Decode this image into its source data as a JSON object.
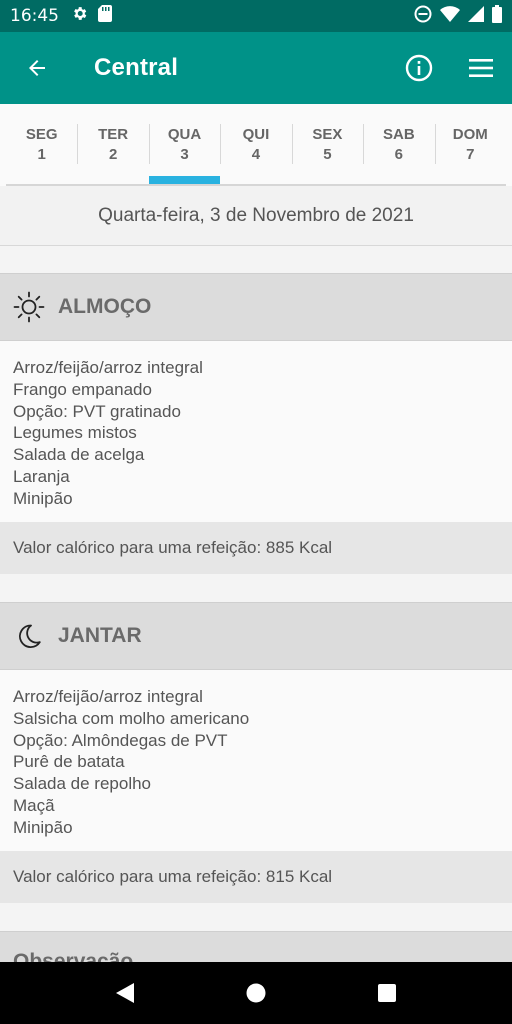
{
  "status_bar": {
    "time": "16:45",
    "left_icons": [
      "settings-icon",
      "sd-card-icon"
    ],
    "right_icons": [
      "do-not-disturb-icon",
      "wifi-icon",
      "signal-icon",
      "battery-icon"
    ]
  },
  "app_bar": {
    "title": "Central",
    "back_icon": "arrow-back-icon",
    "actions": [
      "info-icon",
      "menu-icon"
    ]
  },
  "tabs": [
    {
      "day": "SEG",
      "num": "1"
    },
    {
      "day": "TER",
      "num": "2"
    },
    {
      "day": "QUA",
      "num": "3",
      "selected": true
    },
    {
      "day": "QUI",
      "num": "4"
    },
    {
      "day": "SEX",
      "num": "5"
    },
    {
      "day": "SAB",
      "num": "6"
    },
    {
      "day": "DOM",
      "num": "7"
    }
  ],
  "date_label": "Quarta-feira, 3 de Novembro de 2021",
  "meals": [
    {
      "icon": "sun-icon",
      "title": "ALMOÇO",
      "items": [
        "Arroz/feijão/arroz integral",
        "Frango empanado",
        "Opção: PVT gratinado",
        "Legumes mistos",
        "Salada de acelga",
        "Laranja",
        "Minipão"
      ],
      "calories": "Valor calórico para uma refeição: 885 Kcal"
    },
    {
      "icon": "moon-icon",
      "title": "JANTAR",
      "items": [
        "Arroz/feijão/arroz integral",
        "Salsicha com molho americano",
        "Opção: Almôndegas de PVT",
        "Purê de batata",
        "Salada de repolho",
        "Maçã",
        "Minipão"
      ],
      "calories": "Valor calórico para uma refeição: 815 Kcal"
    }
  ],
  "observacao_title": "Observação",
  "nav_bar": [
    "back-triangle-icon",
    "home-circle-icon",
    "recents-square-icon"
  ],
  "colors": {
    "primary": "#009288",
    "primary_dark": "#006b63",
    "accent": "#29b2e0"
  }
}
